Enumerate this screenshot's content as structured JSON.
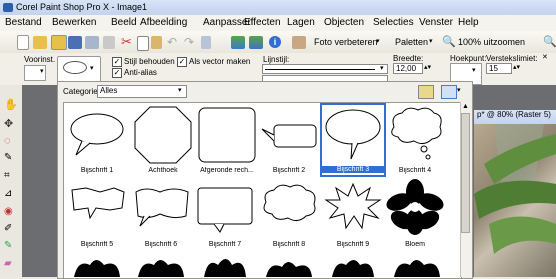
{
  "window": {
    "title": "Corel Paint Shop Pro X - Image1"
  },
  "menu": [
    "Bestand",
    "Bewerken",
    "Beeld",
    "Afbeelding",
    "Aanpassen",
    "Effecten",
    "Lagen",
    "Objecten",
    "Selecties",
    "Venster",
    "Help"
  ],
  "toolbar": {
    "photo_fix": "Foto verbeteren",
    "palettes": "Paletten",
    "zoom": "100% uitzoomen"
  },
  "options": {
    "presets_label": "Voorinst.",
    "keep_style": "Stijl behouden",
    "anti_alias": "Anti-alias",
    "as_vector": "Als vector maken",
    "line_style_label": "Lijnstijl:",
    "width_label": "Breedte:",
    "width_value": "12,00",
    "miter_label": "Hoekpunt:",
    "miter_value": "15",
    "miter_limit_label": "Verstekslimiet:",
    "miter_limit_value": "15",
    "keep_style_checked": true,
    "anti_alias_checked": true,
    "as_vector_checked": true
  },
  "document": {
    "title": "p* @ 80% (Raster 5)"
  },
  "picker": {
    "category_label": "Categorie:",
    "category_value": "Alles",
    "shapes": [
      {
        "label": "Bijschrift 1",
        "selected": false
      },
      {
        "label": "Achthoek",
        "selected": false
      },
      {
        "label": "Afgeronde rech...",
        "selected": false
      },
      {
        "label": "Bijschrift 2",
        "selected": false
      },
      {
        "label": "Bijschrift 3",
        "selected": true
      },
      {
        "label": "Bijschrift 4",
        "selected": false
      },
      {
        "label": "Bijschrift 5",
        "selected": false
      },
      {
        "label": "Bijschrift 6",
        "selected": false
      },
      {
        "label": "Bijschrift 7",
        "selected": false
      },
      {
        "label": "Bijschrift 8",
        "selected": false
      },
      {
        "label": "Bijschrift 9",
        "selected": false
      },
      {
        "label": "Bloem",
        "selected": false
      }
    ]
  },
  "colors": {
    "selection": "#2f6fd1",
    "title_bar": "#c3d3ee"
  }
}
